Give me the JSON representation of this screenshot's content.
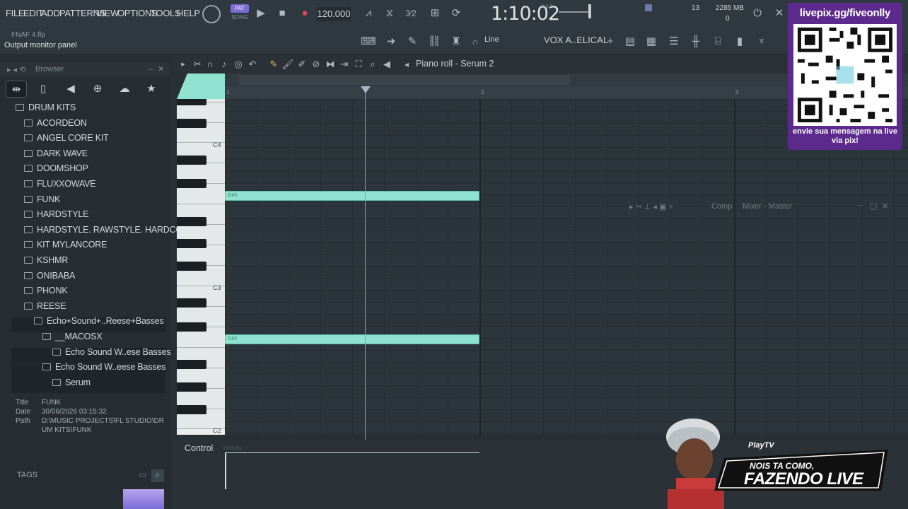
{
  "menu": [
    "FILE",
    "EDIT",
    "ADD",
    "PATTERNS",
    "VIEW",
    "OPTIONS",
    "TOOLS",
    "HELP"
  ],
  "transport": {
    "pat_label": "PAT",
    "song_label": "SONG",
    "tempo": "120.000",
    "time": "1:10:02",
    "time_suffix": "B:S:T",
    "cpu_count": "13",
    "memory": "2285 MB",
    "poly": "0"
  },
  "project": {
    "name": "FNAF 4.flp",
    "hint": "Output monitor panel"
  },
  "toolbar2": {
    "snap": "Line",
    "channel": "VOX A..ELICAL"
  },
  "browser": {
    "title": "Browser",
    "tree": [
      {
        "label": "DRUM KITS",
        "level": 0
      },
      {
        "label": "ACORDEON",
        "level": 1
      },
      {
        "label": "ANGEL CORE KIT",
        "level": 1
      },
      {
        "label": "DARK WAVE",
        "level": 1
      },
      {
        "label": "DOOMSHOP",
        "level": 1
      },
      {
        "label": "FLUXXOWAVE",
        "level": 1
      },
      {
        "label": "FUNK",
        "level": 1
      },
      {
        "label": "HARDSTYLE",
        "level": 1
      },
      {
        "label": "HARDSTYLE. RAWSTYLE. HARDCORE",
        "level": 1
      },
      {
        "label": "KIT MYLANCORE",
        "level": 1
      },
      {
        "label": "KSHMR",
        "level": 1
      },
      {
        "label": "ONIBABA",
        "level": 1
      },
      {
        "label": "PHONK",
        "level": 1
      },
      {
        "label": "REESE",
        "level": 1
      },
      {
        "label": "Echo+Sound+..Reese+Basses",
        "level": 2
      },
      {
        "label": "__MACOSX",
        "level": 3
      },
      {
        "label": "Echo Sound W..ese Basses",
        "level": 4
      },
      {
        "label": "Echo Sound W..eese Basses",
        "level": 3
      },
      {
        "label": "Serum",
        "level": 4
      }
    ],
    "meta": {
      "title_label": "Title",
      "title_value": "FUNK",
      "date_label": "Date",
      "date_value": "30/06/2026 03:15:32",
      "path_label": "Path",
      "path_value_1": "D:\\MUSIC PROJECTS\\FL STUDIO\\DR",
      "path_value_2": "UM KITS\\FUNK"
    },
    "tags_label": "TAGS"
  },
  "piano_roll": {
    "title": "Piano roll - Serum 2",
    "bars": [
      "1",
      "2",
      "3"
    ],
    "key_labels": [
      "C4",
      "C3",
      "C2"
    ],
    "notes": [
      {
        "label": "G#3"
      },
      {
        "label": "G#2"
      }
    ],
    "control_label": "Control",
    "control_value": "Velocity"
  },
  "mixer": {
    "comp": "Comp",
    "title": "Mixer - Master"
  },
  "overlay": {
    "qr_url": "livepix.gg/fiveonlly",
    "qr_caption": "envie sua mensagem na live via pix!",
    "banner_small": "NOIS TA COMO,",
    "banner_big": "FAZENDO LIVE",
    "brand": "PlayTV"
  },
  "colors": {
    "note": "#8fe2cf",
    "accent": "#7a6bd6",
    "overlay_purple": "#5b2a8c"
  }
}
